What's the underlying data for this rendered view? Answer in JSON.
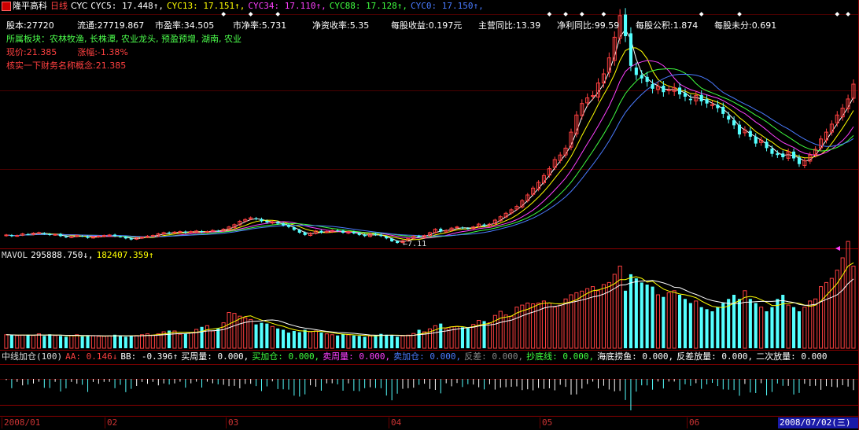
{
  "title_bar": {
    "stock_name": "隆平高科",
    "period": "日线",
    "indicator": "CYC",
    "cyc5": "CYC5: 17.448↑,",
    "cyc13": "CYC13: 17.151↑,",
    "cyc34": "CYC34: 17.110↑,",
    "cyc88": "CYC88: 17.128↑,",
    "cyc0": "CYC0: 17.150↑,"
  },
  "info": {
    "row1": [
      "股本:27720",
      "流通:27719.867",
      "市盈率:34.505",
      "市净率:5.731",
      "净资收率:5.35",
      "每股收益:0.197元",
      "主营同比:13.39",
      "净利同比:99.59",
      "每股公积:1.874",
      "每股未分:0.691"
    ],
    "sector": "所属板块：农林牧渔, 长株潭, 农业龙头, 预盈预增, 湖南, 农业",
    "price": "现价:21.385",
    "change": "涨幅:-1.38%",
    "verify": "核实一下财务名称概念:21.385"
  },
  "annotations": {
    "low_price": "7.11"
  },
  "vol_panel": {
    "label": "MAVOL",
    "v1": "295888.750↓,",
    "v2": "182407.359↑"
  },
  "ind_panel": {
    "label": "中线加仓(100)",
    "aa": "AA: 0.146↓",
    "bb": "BB: -0.396↑",
    "items": [
      "买周量: 0.000,",
      "买加仓: 0.000,",
      "卖周量: 0.000,",
      "卖加仓: 0.000,",
      "反差: 0.000,",
      "抄底线: 0.000,",
      "海底捞鱼: 0.000,",
      "反差放量: 0.000,",
      "二次放量: 0.000"
    ]
  },
  "date_axis": {
    "labels": [
      "2008/01",
      "02",
      "03",
      "04",
      "05",
      "06"
    ],
    "current": "2008/07/02(三)"
  },
  "colors": {
    "up": "#ff4040",
    "down": "#54ffff",
    "panel_line": "#8b0000",
    "cyc5": "#ffffff",
    "cyc13": "#ffff00",
    "cyc34": "#ff40ff",
    "cyc88": "#40ff40",
    "cyc0": "#4a7bff"
  },
  "chart_data": {
    "type": "candlestick",
    "price_series": [
      3.4,
      3.3,
      3.35,
      3.5,
      3.45,
      3.55,
      3.6,
      3.5,
      3.4,
      3.45,
      3.3,
      3.2,
      3.25,
      3.35,
      3.3,
      3.15,
      3.2,
      3.3,
      3.35,
      3.4,
      3.3,
      3.25,
      3.1,
      3.0,
      3.15,
      3.2,
      3.3,
      3.35,
      3.5,
      3.6,
      3.55,
      3.65,
      3.7,
      3.6,
      3.7,
      3.75,
      3.65,
      3.7,
      3.8,
      3.75,
      3.9,
      4.1,
      4.3,
      4.6,
      4.75,
      4.9,
      4.8,
      4.6,
      4.5,
      4.55,
      4.4,
      4.25,
      4.1,
      3.85,
      3.6,
      3.4,
      3.55,
      3.75,
      3.6,
      3.7,
      3.8,
      3.75,
      3.6,
      3.7,
      3.55,
      3.4,
      3.3,
      3.5,
      3.4,
      3.3,
      3.1,
      2.85,
      2.7,
      2.9,
      3.1,
      3.3,
      3.25,
      3.35,
      3.6,
      3.9,
      3.7,
      3.8,
      4.0,
      4.1,
      4.0,
      3.95,
      4.1,
      4.35,
      4.2,
      4.35,
      4.7,
      5.0,
      5.3,
      5.6,
      5.9,
      6.4,
      6.9,
      7.5,
      8.0,
      8.6,
      9.2,
      10.0,
      10.4,
      11.0,
      12.4,
      13.9,
      14.9,
      15.4,
      15.6,
      16.7,
      17.5,
      18.9,
      20.7,
      22.6,
      20.8,
      18.2,
      17.4,
      17.1,
      16.8,
      16.2,
      16.4,
      15.9,
      16.1,
      16.3,
      15.7,
      15.5,
      15.2,
      15.6,
      15.1,
      14.9,
      14.8,
      14.5,
      14.0,
      13.5,
      13.0,
      12.2,
      12.6,
      12.0,
      11.4,
      11.7,
      11.0,
      10.5,
      10.4,
      10.2,
      10.7,
      10.1,
      9.6,
      9.9,
      10.4,
      10.9,
      11.8,
      12.4,
      13.1,
      13.9,
      14.5,
      15.3,
      16.6
    ],
    "volume_series": [
      0.33,
      0.32,
      0.31,
      0.32,
      0.33,
      0.31,
      0.35,
      0.3,
      0.34,
      0.31,
      0.3,
      0.28,
      0.31,
      0.33,
      0.29,
      0.31,
      0.3,
      0.29,
      0.29,
      0.3,
      0.33,
      0.31,
      0.28,
      0.3,
      0.31,
      0.33,
      0.35,
      0.32,
      0.35,
      0.4,
      0.43,
      0.42,
      0.34,
      0.35,
      0.38,
      0.46,
      0.52,
      0.55,
      0.42,
      0.48,
      0.62,
      0.87,
      0.85,
      0.78,
      0.74,
      0.7,
      0.58,
      0.62,
      0.6,
      0.53,
      0.48,
      0.45,
      0.38,
      0.42,
      0.39,
      0.45,
      0.4,
      0.42,
      0.38,
      0.35,
      0.33,
      0.31,
      0.35,
      0.33,
      0.31,
      0.3,
      0.28,
      0.3,
      0.32,
      0.35,
      0.33,
      0.31,
      0.28,
      0.3,
      0.32,
      0.36,
      0.45,
      0.4,
      0.47,
      0.55,
      0.6,
      0.47,
      0.52,
      0.53,
      0.51,
      0.49,
      0.58,
      0.68,
      0.66,
      0.62,
      0.8,
      0.9,
      0.81,
      0.78,
      1.0,
      1.05,
      1.1,
      1.08,
      1.1,
      1.15,
      1.1,
      1.0,
      1.05,
      1.2,
      1.3,
      1.35,
      1.39,
      1.45,
      1.5,
      1.4,
      1.55,
      1.6,
      1.8,
      2.0,
      1.4,
      1.8,
      1.7,
      1.6,
      1.55,
      1.5,
      1.3,
      1.25,
      1.35,
      1.4,
      1.3,
      1.2,
      1.1,
      1.15,
      1.0,
      0.95,
      0.9,
      1.0,
      1.1,
      1.2,
      1.3,
      1.2,
      1.4,
      1.2,
      1.1,
      1.0,
      0.9,
      1.0,
      1.2,
      1.3,
      1.05,
      1.0,
      0.9,
      1.0,
      1.15,
      1.2,
      1.5,
      1.6,
      1.7,
      1.9,
      2.2,
      2.6,
      2.0
    ]
  }
}
